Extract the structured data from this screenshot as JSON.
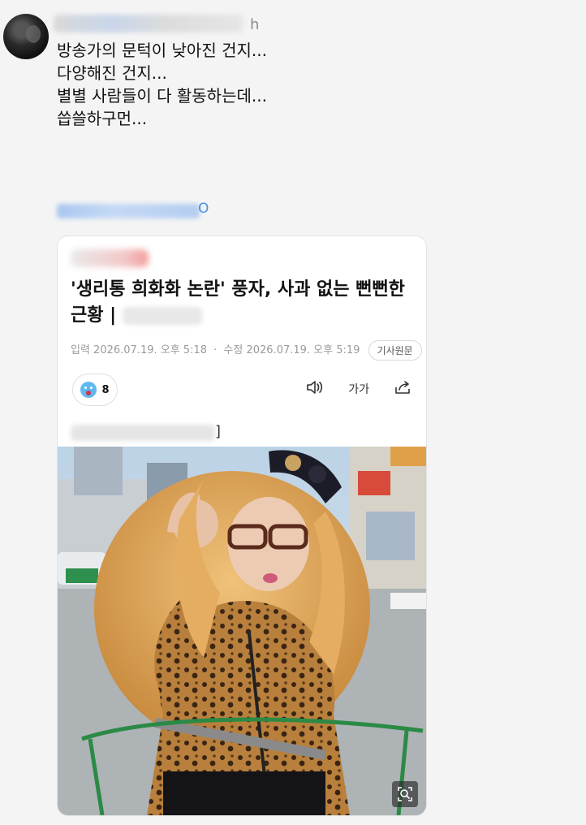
{
  "post": {
    "time": "h",
    "lines": [
      "방송가의 문턱이 낮아진 건지...",
      "다양해진 건지...",
      "",
      "별별 사람들이 다 활동하는데...",
      "",
      "씁쓸하구먼..."
    ],
    "link_tail": "O"
  },
  "article": {
    "headline": "'생리통 희화화 논란' 풍자, 사과 없는 뻔뻔한 근황 |",
    "meta": {
      "published": "입력 2026.07.19. 오후 5:18",
      "separator": "·",
      "modified": "수정 2026.07.19. 오후 5:19",
      "original_button": "기사원문"
    },
    "reaction_count": "8",
    "font_tool": "가가",
    "caption_tail": "]"
  },
  "colors": {
    "link": "#4a90e2",
    "reaction": "#5fb8f0"
  },
  "icons": [
    "speaker-icon",
    "font-size-icon",
    "share-icon",
    "zoom-icon",
    "surprised-emoji-icon"
  ]
}
